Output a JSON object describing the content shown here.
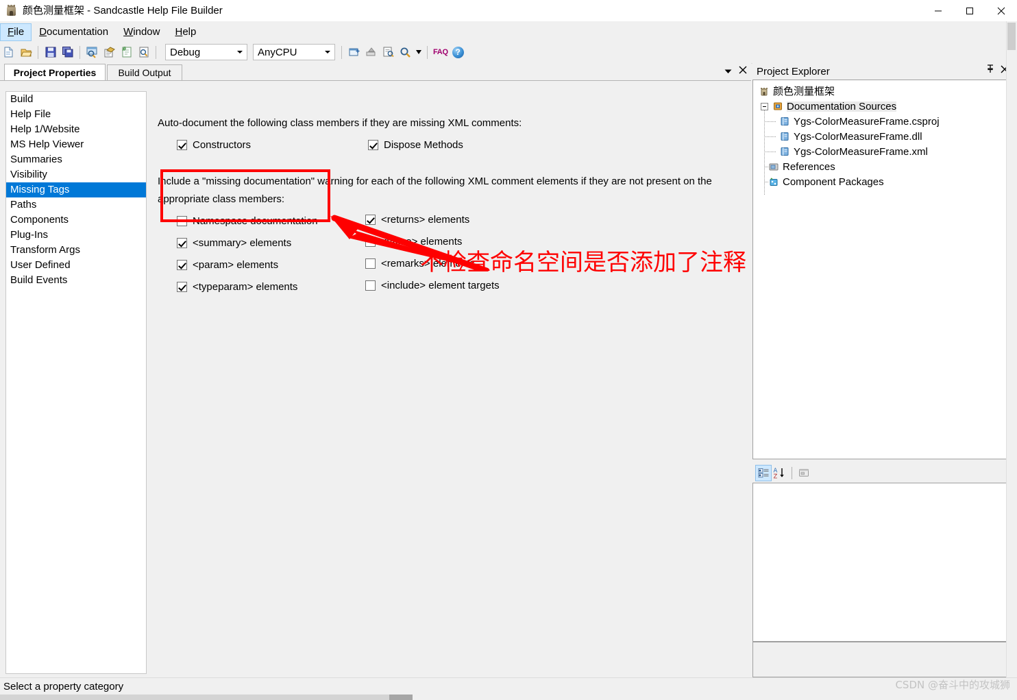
{
  "window": {
    "title": "颜色测量框架 - Sandcastle Help File Builder",
    "app_icon": "sandcastle-icon",
    "controls": {
      "minimize": "minimize-icon",
      "maximize": "maximize-icon",
      "close": "close-icon"
    }
  },
  "menu": {
    "items": [
      {
        "label": "File",
        "mnemonic": "F",
        "selected": true
      },
      {
        "label": "Documentation",
        "mnemonic": "D",
        "selected": false
      },
      {
        "label": "Window",
        "mnemonic": "W",
        "selected": false
      },
      {
        "label": "Help",
        "mnemonic": "H",
        "selected": false
      }
    ]
  },
  "toolbar": {
    "icons_group1": [
      "new-project-icon",
      "open-project-icon"
    ],
    "icons_group2": [
      "save-icon",
      "save-all-icon"
    ],
    "icons_group3": [
      "preview-icon",
      "build-icon",
      "view-help-file-icon",
      "search-help-icon"
    ],
    "configuration": {
      "value": "Debug"
    },
    "platform": {
      "value": "AnyCPU"
    },
    "icons_group4": [
      "add-documentation-source-icon",
      "add-references-icon",
      "entity-references-icon",
      "search-icon"
    ],
    "faq_label": "FAQ",
    "help_label": "?"
  },
  "document": {
    "tabs": [
      {
        "label": "Project Properties",
        "active": true
      },
      {
        "label": "Build Output",
        "active": false
      }
    ],
    "tab_tools": {
      "dropdown": "chevron-down-icon",
      "close": "close-icon"
    }
  },
  "categories": {
    "items": [
      {
        "label": "Build",
        "selected": false
      },
      {
        "label": "Help File",
        "selected": false
      },
      {
        "label": "Help 1/Website",
        "selected": false
      },
      {
        "label": "MS Help Viewer",
        "selected": false
      },
      {
        "label": "Summaries",
        "selected": false
      },
      {
        "label": "Visibility",
        "selected": false
      },
      {
        "label": "Missing Tags",
        "selected": true
      },
      {
        "label": "Paths",
        "selected": false
      },
      {
        "label": "Components",
        "selected": false
      },
      {
        "label": "Plug-Ins",
        "selected": false
      },
      {
        "label": "Transform Args",
        "selected": false
      },
      {
        "label": "User Defined",
        "selected": false
      },
      {
        "label": "Build Events",
        "selected": false
      }
    ]
  },
  "missing_tags": {
    "autodoc_heading": "Auto-document the following class members if they are missing XML comments:",
    "autodoc_options": [
      {
        "label": "Constructors",
        "checked": true
      },
      {
        "label": "Dispose Methods",
        "checked": true
      }
    ],
    "warning_heading_line1": "Include a \"missing documentation\" warning for each of the following XML comment elements if they are not present on the",
    "warning_heading_line2": "appropriate class members:",
    "left_column": [
      {
        "label": "Namespace documentation",
        "checked": false
      },
      {
        "label": "<summary> elements",
        "checked": true
      },
      {
        "label": "<param> elements",
        "checked": true
      },
      {
        "label": "<typeparam> elements",
        "checked": true
      }
    ],
    "right_column": [
      {
        "label": "<returns> elements",
        "checked": true
      },
      {
        "label": "<value> elements",
        "checked": false
      },
      {
        "label": "<remarks> elements",
        "checked": false
      },
      {
        "label": "<include> element targets",
        "checked": false
      }
    ]
  },
  "annotation": {
    "text": "不检查命名空间是否添加了注释",
    "color": "#fe0000",
    "box_present": true,
    "arrow_present": true
  },
  "project_explorer": {
    "title": "Project Explorer",
    "pin_icon": "pin-icon",
    "close_icon": "close-icon",
    "tree": [
      {
        "label": "颜色测量框架",
        "icon": "project-icon",
        "level": 0,
        "expander": "none"
      },
      {
        "label": "Documentation Sources",
        "icon": "documentation-sources-icon",
        "level": 1,
        "expander": "collapse",
        "highlighted": true
      },
      {
        "label": "Ygs-ColorMeasureFrame.csproj",
        "icon": "document-source-icon",
        "level": 2,
        "expander": "none"
      },
      {
        "label": "Ygs-ColorMeasureFrame.dll",
        "icon": "document-source-icon",
        "level": 2,
        "expander": "none"
      },
      {
        "label": "Ygs-ColorMeasureFrame.xml",
        "icon": "document-source-icon",
        "level": 2,
        "expander": "none"
      },
      {
        "label": "References",
        "icon": "references-icon",
        "level": 1,
        "expander": "none"
      },
      {
        "label": "Component Packages",
        "icon": "component-packages-icon",
        "level": 1,
        "expander": "none"
      }
    ]
  },
  "property_grid": {
    "toolbar": [
      {
        "name": "categorized-view-button",
        "selected": true
      },
      {
        "name": "alphabetical-sort-button",
        "selected": false
      },
      {
        "name": "property-pages-button",
        "selected": false
      }
    ]
  },
  "statusbar": {
    "message": "Select a property category"
  },
  "watermark": {
    "text": "CSDN @奋斗中的攻城狮"
  },
  "colors": {
    "accent": "#0078d7",
    "annotation_red": "#fe0000",
    "window_bg": "#f0f0f0",
    "panel_bg": "#ffffff"
  }
}
